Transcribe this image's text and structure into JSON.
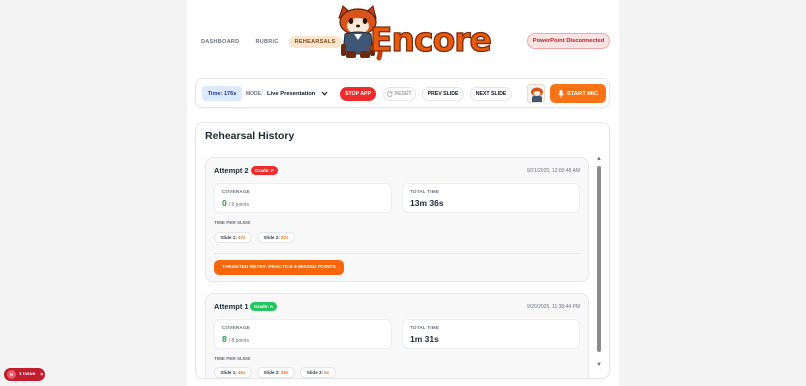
{
  "app": {
    "name": "Encore"
  },
  "nav": {
    "items": [
      "DASHBOARD",
      "RUBRIC",
      "REHEARSALS"
    ],
    "active": "REHEARSALS"
  },
  "status": {
    "powerpoint": "PowerPoint Disconnected"
  },
  "toolbar": {
    "time": "Time: 176s",
    "mode_label": "MODE:",
    "mode_value": "Live Presentation",
    "stop": "STOP APP",
    "reset": "RESET",
    "prev": "PREV SLIDE",
    "next": "NEXT SLIDE",
    "mic": "START MIC"
  },
  "history": {
    "title": "Rehearsal History",
    "attempts": [
      {
        "title": "Attempt 2",
        "grade": "Grade: F",
        "grade_color": "#ef2b2b",
        "date": "9/21/2025, 12:00:48 AM",
        "coverage_label": "COVERAGE",
        "coverage_value": "0",
        "coverage_total": "/ 9 points",
        "total_time_label": "TOTAL TIME",
        "total_time": "13m 36s",
        "tps_label": "TIME PER SLIDE",
        "slides": [
          {
            "name": "Slide 1:",
            "time": "47s"
          },
          {
            "name": "Slide 2:",
            "time": "37s"
          }
        ],
        "retry": "TARGETED RETRY: PRACTICE 9 MISSED POINTS"
      },
      {
        "title": "Attempt 1",
        "grade": "Grade: A",
        "grade_color": "#22c55e",
        "date": "9/20/2025, 11:38:44 PM",
        "coverage_label": "COVERAGE",
        "coverage_value": "8",
        "coverage_total": "/ 8 points",
        "total_time_label": "TOTAL TIME",
        "total_time": "1m 31s",
        "tps_label": "TIME PER SLIDE",
        "slides": [
          {
            "name": "Slide 1:",
            "time": "46s"
          },
          {
            "name": "Slide 2:",
            "time": "38s"
          },
          {
            "name": "Slide 3:",
            "time": "5s"
          }
        ]
      }
    ]
  },
  "dev_overlay": {
    "badge": "N",
    "text": "1 Issue",
    "close": "×"
  },
  "colors": {
    "accent": "#f97316",
    "danger": "#ef2b2b",
    "success": "#22a04b"
  }
}
